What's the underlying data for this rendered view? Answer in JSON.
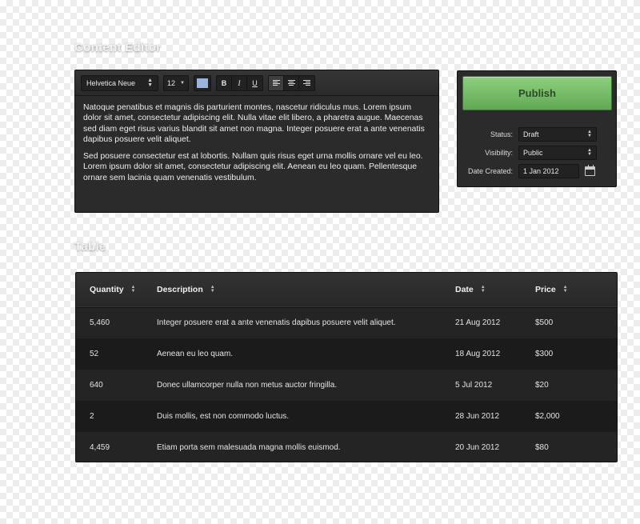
{
  "sections": {
    "editor_title": "Content Editor",
    "table_title": "Table"
  },
  "toolbar": {
    "font_family": "Helvetica Neue",
    "font_size": "12",
    "text_color": "#9ab5dd",
    "bold_label": "B",
    "italic_label": "I",
    "underline_label": "U",
    "align_left_icon": "align-left-icon",
    "align_center_icon": "align-center-icon",
    "align_right_icon": "align-right-icon"
  },
  "editor": {
    "paragraph1": "Natoque penatibus et magnis dis parturient montes, nascetur ridiculus mus. Lorem ipsum dolor sit amet, consectetur adipiscing elit. Nulla vitae elit libero, a pharetra augue. Maecenas sed diam eget risus varius blandit sit amet non magna. Integer posuere erat a ante venenatis dapibus posuere velit aliquet.",
    "paragraph2": "Sed posuere consectetur est at lobortis. Nullam quis risus eget urna mollis ornare vel eu leo. Lorem ipsum dolor sit amet, consectetur adipiscing elit. Aenean eu leo quam. Pellentesque ornare sem lacinia quam venenatis vestibulum."
  },
  "publish": {
    "button_label": "Publish",
    "button_color": "#72bb63",
    "status_label": "Status:",
    "status_value": "Draft",
    "visibility_label": "Visibility:",
    "visibility_value": "Public",
    "date_label": "Date Created:",
    "date_value": "1 Jan 2012",
    "calendar_icon": "calendar-icon"
  },
  "table": {
    "headers": [
      "Quantity",
      "Description",
      "Date",
      "Price"
    ],
    "rows": [
      [
        "5,460",
        "Integer posuere erat a ante venenatis dapibus posuere velit aliquet.",
        "21 Aug 2012",
        "$500"
      ],
      [
        "52",
        "Aenean eu leo quam.",
        "18 Aug 2012",
        "$300"
      ],
      [
        "640",
        "Donec ullamcorper nulla non metus auctor fringilla.",
        "5 Jul 2012",
        "$20"
      ],
      [
        "2",
        "Duis mollis, est non commodo luctus.",
        "28 Jun 2012",
        "$2,000"
      ],
      [
        "4,459",
        "Etiam porta sem malesuada magna mollis euismod.",
        "20 Jun 2012",
        "$80"
      ]
    ]
  }
}
